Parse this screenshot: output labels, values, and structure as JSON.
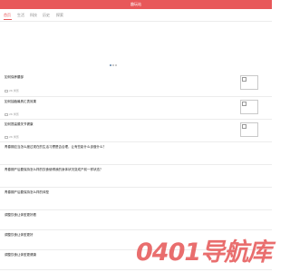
{
  "header": {
    "title": "趣玩站"
  },
  "nav": {
    "items": [
      "首页",
      "生活",
      "科技",
      "历史",
      "探索"
    ]
  },
  "articles": [
    {
      "title": "如何保养腰部",
      "views": "26 浏览",
      "has_thumb": true
    },
    {
      "title": "如何抽脂最具汇表效果",
      "views": "26 浏览",
      "has_thumb": true
    },
    {
      "title": "如何提高膝关节健康",
      "views": "26 浏览",
      "has_thumb": true
    },
    {
      "title": "青春期应当怎么度过现在的生活习惯是否合理，让有些影什么该做什么？",
      "views": "",
      "has_thumb": false
    },
    {
      "title": "青春期产后要保持怎么样的饮食使得我的身体状况变成产前一样状态？",
      "views": "",
      "has_thumb": false
    },
    {
      "title": "青春期产后要保持怎么样的体型",
      "views": "",
      "has_thumb": false
    },
    {
      "title": "调整饮食让体型更好看",
      "views": "",
      "has_thumb": false
    },
    {
      "title": "调整饮食让体型更好",
      "views": "",
      "has_thumb": false
    },
    {
      "title": "调整饮食让体型更健康",
      "views": "",
      "has_thumb": false
    }
  ],
  "watermark": "0401导航库",
  "colors": {
    "brand": "#e8585a",
    "accent_dot": "#5b7fa6"
  }
}
